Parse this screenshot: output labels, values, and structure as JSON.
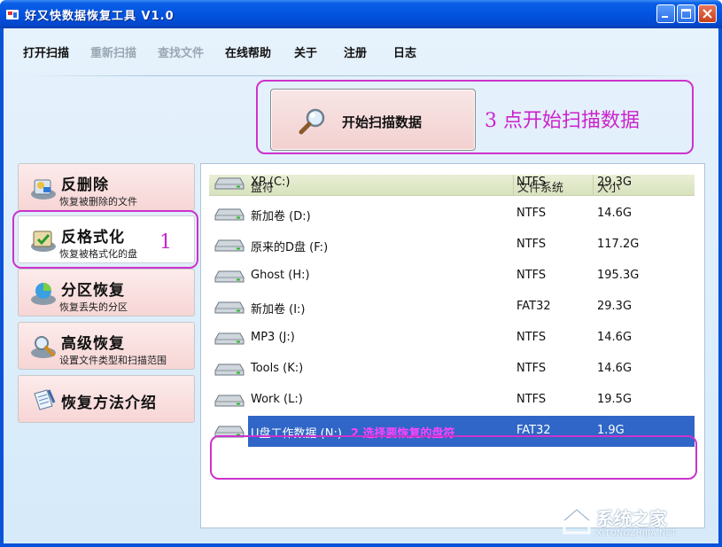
{
  "window": {
    "title": "好又快数据恢复工具 V1.0"
  },
  "menu": [
    {
      "label": "打开扫描",
      "enabled": true
    },
    {
      "label": "重新扫描",
      "enabled": false
    },
    {
      "label": "查找文件",
      "enabled": false
    },
    {
      "label": "在线帮助",
      "enabled": true
    },
    {
      "label": "关于",
      "enabled": true
    },
    {
      "label": "注册",
      "enabled": true
    },
    {
      "label": "日志",
      "enabled": true
    }
  ],
  "scan_button": {
    "label": "开始扫描数据",
    "icon": "magnifier-icon"
  },
  "annotations": {
    "step1": "1",
    "step2": "2 选择要恢复的盘符",
    "step3": "3 点开始扫描数据",
    "color": "#cc33cc"
  },
  "nav": [
    {
      "title": "反删除",
      "subtitle": "恢复被删除的文件",
      "icon": "undelete-icon",
      "active": false
    },
    {
      "title": "反格式化",
      "subtitle": "恢复被格式化的盘",
      "icon": "unformat-icon",
      "active": true
    },
    {
      "title": "分区恢复",
      "subtitle": "恢复丢失的分区",
      "icon": "partition-recovery-icon",
      "active": false
    },
    {
      "title": "高级恢复",
      "subtitle": "设置文件类型和扫描范围",
      "icon": "advanced-recovery-icon",
      "active": false
    },
    {
      "title": "恢复方法介绍",
      "subtitle": "",
      "icon": "guide-icon",
      "active": false
    }
  ],
  "table": {
    "headers": [
      "盘符",
      "文件系统",
      "大小"
    ],
    "rows": [
      {
        "drive": "XP (C:)",
        "fs": "NTFS",
        "size": "29.3G"
      },
      {
        "drive": "新加卷 (D:)",
        "fs": "NTFS",
        "size": "14.6G"
      },
      {
        "drive": "原来的D盘 (F:)",
        "fs": "NTFS",
        "size": "117.2G"
      },
      {
        "drive": "Ghost (H:)",
        "fs": "NTFS",
        "size": "195.3G"
      },
      {
        "drive": "新加卷 (I:)",
        "fs": "FAT32",
        "size": "29.3G"
      },
      {
        "drive": "MP3 (J:)",
        "fs": "NTFS",
        "size": "14.6G"
      },
      {
        "drive": "Tools (K:)",
        "fs": "NTFS",
        "size": "14.6G"
      },
      {
        "drive": "Work (L:)",
        "fs": "NTFS",
        "size": "19.5G"
      },
      {
        "drive": "U盘工作数据 (N:)",
        "fs": "FAT32",
        "size": "1.9G",
        "selected": true
      }
    ]
  },
  "watermark": {
    "cn": "系统之家",
    "en": "XITONGZHIJIA.NET"
  },
  "colors": {
    "titlebar": "#0254e0",
    "selection": "#2f66c7",
    "header": "#d8e2bd",
    "nav_button": "#f7d5d5"
  }
}
